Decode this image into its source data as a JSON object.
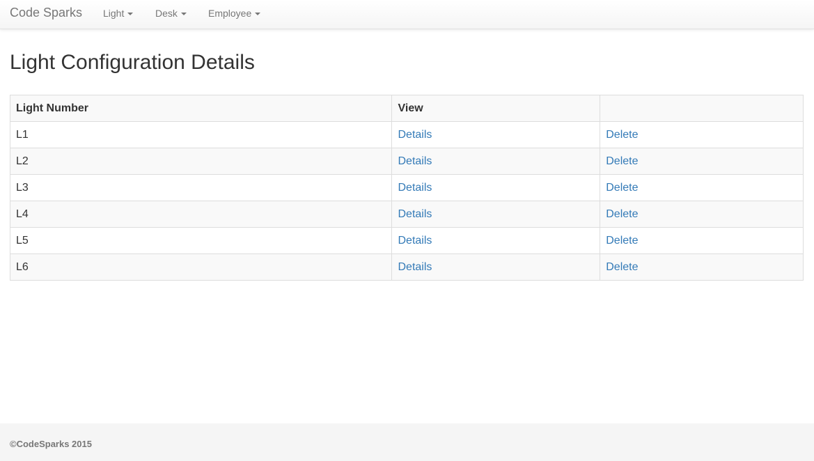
{
  "navbar": {
    "brand": "Code Sparks",
    "menus": [
      {
        "label": "Light"
      },
      {
        "label": "Desk"
      },
      {
        "label": "Employee"
      }
    ]
  },
  "main": {
    "title": "Light Configuration Details",
    "table": {
      "columns": [
        "Light Number",
        "View",
        ""
      ],
      "rows": [
        {
          "light_number": "L1",
          "view_link": "Details",
          "action_link": "Delete"
        },
        {
          "light_number": "L2",
          "view_link": "Details",
          "action_link": "Delete"
        },
        {
          "light_number": "L3",
          "view_link": "Details",
          "action_link": "Delete"
        },
        {
          "light_number": "L4",
          "view_link": "Details",
          "action_link": "Delete"
        },
        {
          "light_number": "L5",
          "view_link": "Details",
          "action_link": "Delete"
        },
        {
          "light_number": "L6",
          "view_link": "Details",
          "action_link": "Delete"
        }
      ]
    }
  },
  "footer": {
    "text": "©CodeSparks 2015"
  },
  "colors": {
    "link": "#337ab7",
    "navbar_text": "#777777",
    "body_text": "#333333",
    "stripe": "#f9f9f9",
    "footer_bg": "#f5f5f5"
  }
}
